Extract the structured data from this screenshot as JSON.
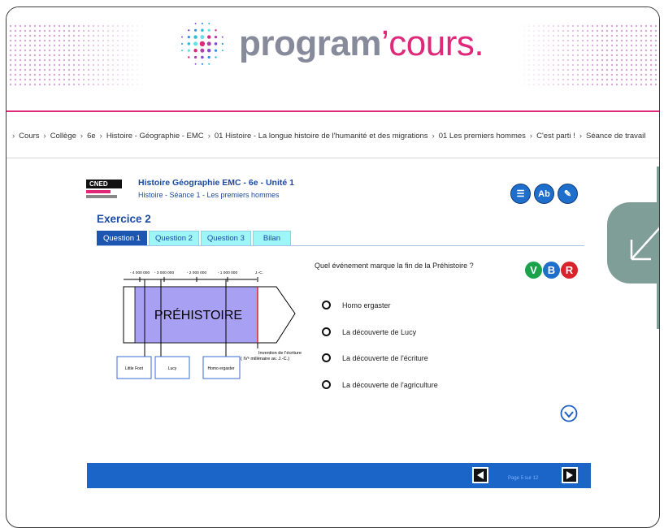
{
  "header": {
    "logo_main": "program",
    "logo_apostrophe": "’",
    "logo_accent": "cours.",
    "brand_color": "#e0287a"
  },
  "breadcrumb": {
    "items": [
      "Cours",
      "Collège",
      "6e",
      "Histoire - Géographie - EMC",
      "01 Histoire - La longue histoire de l'humanité et des migrations",
      "01 Les premiers hommes",
      "C'est parti !",
      "Séance de travail"
    ]
  },
  "app": {
    "cned_logo_text": "CNED",
    "course_title": "Histoire Géographie EMC - 6e - Unité 1",
    "course_subtitle": "Histoire - Séance 1 - Les premiers hommes",
    "tool_icons": [
      "list-icon",
      "dictionary-icon",
      "notes-icon"
    ],
    "exercise_title": "Exercice 2",
    "tabs": [
      {
        "label": "Question 1",
        "active": true
      },
      {
        "label": "Question 2",
        "active": false
      },
      {
        "label": "Question 3",
        "active": false
      },
      {
        "label": "Bilan",
        "active": false
      }
    ]
  },
  "figure": {
    "ticks": [
      "- 4 000 000",
      "- 3 000 000",
      "- 2 000 000",
      "- 1 000 000",
      "J.-C."
    ],
    "period_label": "PRÉHISTOIRE",
    "invention_line1": "Invention de l'écriture",
    "invention_line2": "( IVᵉ millénaire av. J.-C.)",
    "boxes": [
      "Little Foot",
      "Lucy",
      "Homo ergaster"
    ]
  },
  "question": {
    "text": "Quel événement marque la fin de la Préhistoire ?",
    "vbr_buttons": [
      {
        "label": "V",
        "color": "#1aa34a"
      },
      {
        "label": "B",
        "color": "#1e6fcc"
      },
      {
        "label": "R",
        "color": "#d8232a"
      }
    ],
    "answers": [
      "Homo ergaster",
      "La découverte de Lucy",
      "La découverte de l'écriture",
      "La découverte de l'agriculture"
    ]
  },
  "footer": {
    "page_info": "Page 5 sur 12"
  }
}
